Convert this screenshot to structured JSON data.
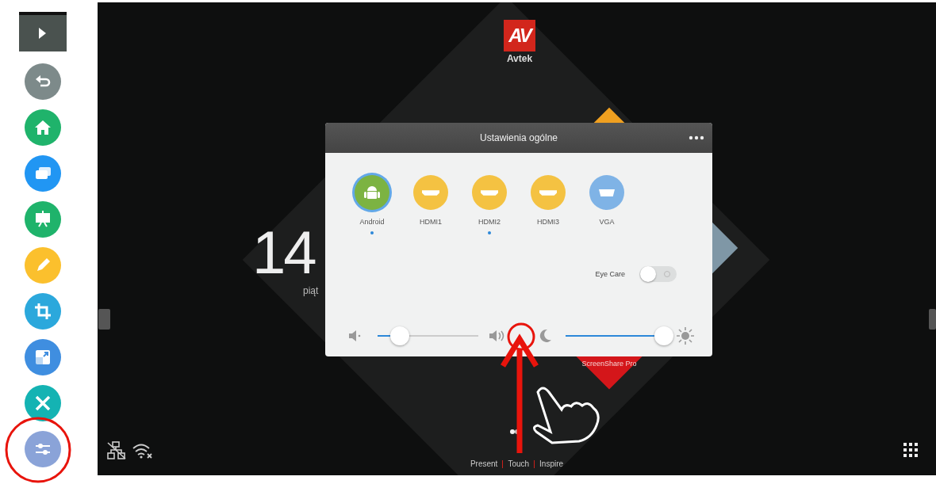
{
  "toolbar": {
    "items": [
      {
        "kind": "collapse",
        "color": "#4a524f"
      },
      {
        "kind": "back",
        "color": "#7d8a8a"
      },
      {
        "kind": "home",
        "color": "#1fb36b"
      },
      {
        "kind": "windows",
        "color": "#2196f3"
      },
      {
        "kind": "whiteboard",
        "color": "#1fb36b"
      },
      {
        "kind": "pen",
        "color": "#fbc02d"
      },
      {
        "kind": "crop",
        "color": "#2ba8dc"
      },
      {
        "kind": "resize",
        "color": "#3f8ee0"
      },
      {
        "kind": "tools",
        "color": "#14b3b3"
      },
      {
        "kind": "settings",
        "color": "#8aa3d8"
      }
    ]
  },
  "home": {
    "logo_mark": "AV",
    "logo_name": "Avtek",
    "clock": "14",
    "day": "piąt",
    "screenshare_tile": "ScreenShare Pro",
    "modes": [
      {
        "label": "Present"
      },
      {
        "label": "Touch"
      },
      {
        "label": "Inspire"
      }
    ]
  },
  "dialog": {
    "title": "Ustawienia ogólne",
    "sources": [
      {
        "label": "Android",
        "kind": "android",
        "selected": true,
        "signal": true
      },
      {
        "label": "HDMI1",
        "kind": "hdmi",
        "selected": false,
        "signal": false
      },
      {
        "label": "HDMI2",
        "kind": "hdmi",
        "selected": false,
        "signal": true
      },
      {
        "label": "HDMI3",
        "kind": "hdmi",
        "selected": false,
        "signal": false
      },
      {
        "label": "VGA",
        "kind": "vga",
        "selected": false,
        "signal": false
      }
    ],
    "eye_care": {
      "label": "Eye Care",
      "on": false
    },
    "volume": {
      "level": 0.22
    },
    "brightness": {
      "level": 0.97
    }
  }
}
